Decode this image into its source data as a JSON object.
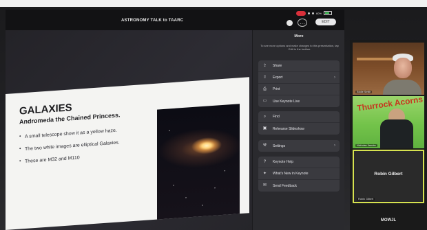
{
  "presentation": {
    "title": "ASTRONOMY TALK to TAARC"
  },
  "toolbar": {
    "more_icon": "ellipsis-circle-icon",
    "edit_label": "EDIT"
  },
  "status_bar": {
    "recording_badge": "",
    "battery_label": "60%"
  },
  "slide": {
    "heading": "GALAXIES",
    "subheading": "Andromeda the Chained Princess.",
    "bullets": [
      "A small telescope show it as a yellow haze.",
      "The two white images are elliptical Galaxies.",
      "These are M32 and M110"
    ],
    "image_icon": "andromeda-galaxy-photo"
  },
  "more_menu": {
    "title": "More",
    "description": "To see more options and make changes to this presentation, tap Edit in the toolbar.",
    "group1": [
      {
        "label": "Share",
        "icon": "share-icon"
      },
      {
        "label": "Export",
        "icon": "export-icon",
        "chevron": "›"
      },
      {
        "label": "Print",
        "icon": "print-icon"
      },
      {
        "label": "Use Keynote Live",
        "icon": "keynote-live-icon"
      }
    ],
    "group2": [
      {
        "label": "Find",
        "icon": "search-icon"
      },
      {
        "label": "Rehearse Slideshow",
        "icon": "rehearse-icon"
      }
    ],
    "group3": [
      {
        "label": "Settings",
        "icon": "wrench-icon",
        "chevron": "›"
      }
    ],
    "group4": [
      {
        "label": "Keynote Help",
        "icon": "help-icon"
      },
      {
        "label": "What's New in Keynote",
        "icon": "lightbulb-icon"
      },
      {
        "label": "Send Feedback",
        "icon": "feedback-icon"
      }
    ]
  },
  "participants": [
    {
      "name": "Eddie Smith"
    },
    {
      "name": "Nicholas Jacobs",
      "banner": "Thurrock Acorns"
    },
    {
      "name": "Robin Gilbert",
      "center": "Robin Gilbert"
    }
  ],
  "next_participant": "MOWJL"
}
